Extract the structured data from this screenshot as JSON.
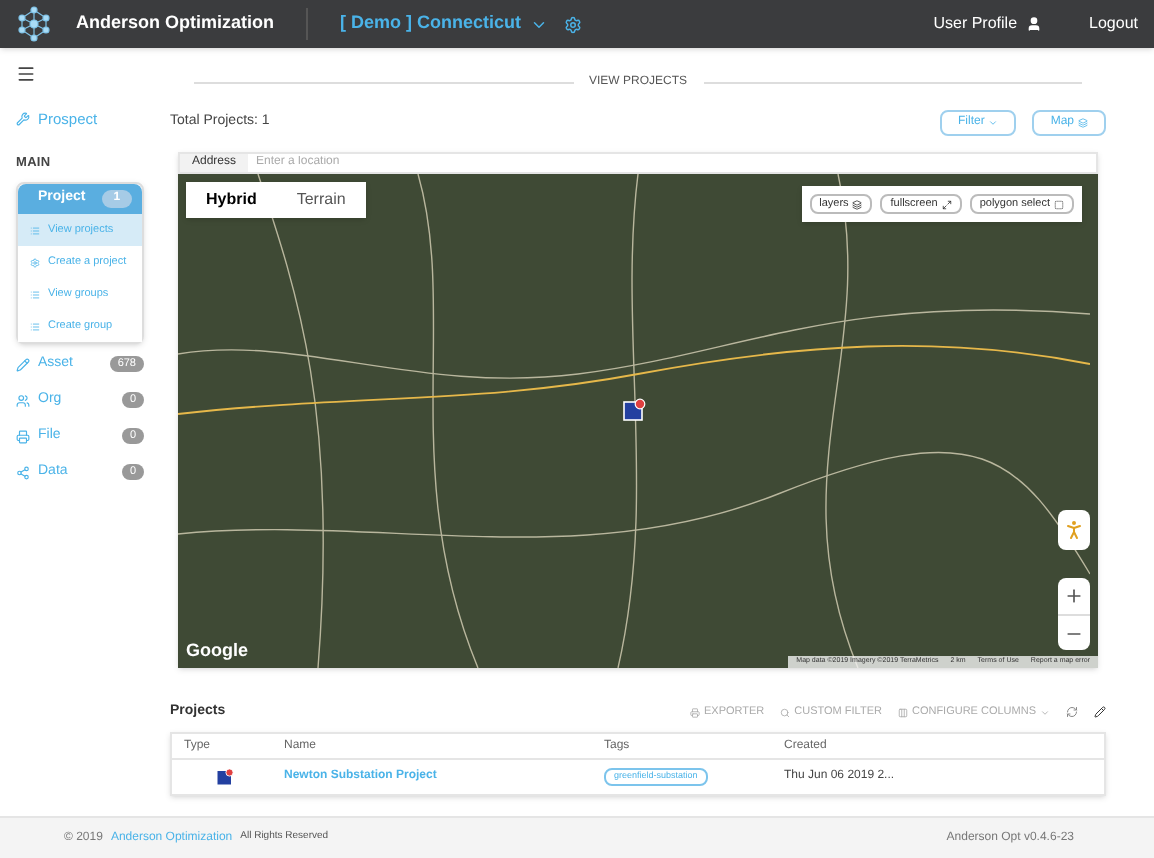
{
  "header": {
    "brand": "Anderson Optimization",
    "project": "[ Demo ] Connecticut",
    "user": "User Profile",
    "logout": "Logout"
  },
  "sidebar": {
    "prospect": "Prospect",
    "section": "MAIN",
    "items": [
      {
        "label": "Project",
        "count": "1",
        "expanded": true,
        "children": [
          {
            "label": "View projects",
            "selected": true
          },
          {
            "label": "Create a project",
            "selected": false
          },
          {
            "label": "View groups",
            "selected": false
          },
          {
            "label": "Create group",
            "selected": false
          }
        ]
      },
      {
        "label": "Asset",
        "count": "678",
        "expanded": false
      },
      {
        "label": "Org",
        "count": "0",
        "expanded": false
      },
      {
        "label": "File",
        "count": "0",
        "expanded": false
      },
      {
        "label": "Data",
        "count": "0",
        "expanded": false
      }
    ]
  },
  "page": {
    "title": "VIEW PROJECTS",
    "total": "Total Projects: 1",
    "buttons": [
      "Filter",
      "Map"
    ]
  },
  "address": {
    "label": "Address",
    "placeholder": "Enter a location"
  },
  "map": {
    "types": [
      {
        "label": "Hybrid",
        "selected": true
      },
      {
        "label": "Terrain",
        "selected": false
      }
    ],
    "tools": [
      "layers",
      "fullscreen",
      "polygon select"
    ],
    "logo": "Google",
    "attribution": [
      "Map data ©2019 Imagery ©2019 TerraMetrics",
      "2 km",
      "Terms of Use",
      "Report a map error"
    ]
  },
  "projects": {
    "title": "Projects",
    "actions": [
      "EXPORTER",
      "CUSTOM FILTER",
      "CONFIGURE COLUMNS"
    ],
    "columns": [
      "Type",
      "Name",
      "Tags",
      "Created"
    ],
    "rows": [
      {
        "name": "Newton Substation Project",
        "tag": "greenfield-substation",
        "created": "Thu Jun 06 2019 2..."
      }
    ]
  },
  "footer": {
    "copyright": "© 2019",
    "company": "Anderson Optimization",
    "rights": "All Rights Reserved",
    "version": "Anderson Opt v0.4.6-23"
  }
}
